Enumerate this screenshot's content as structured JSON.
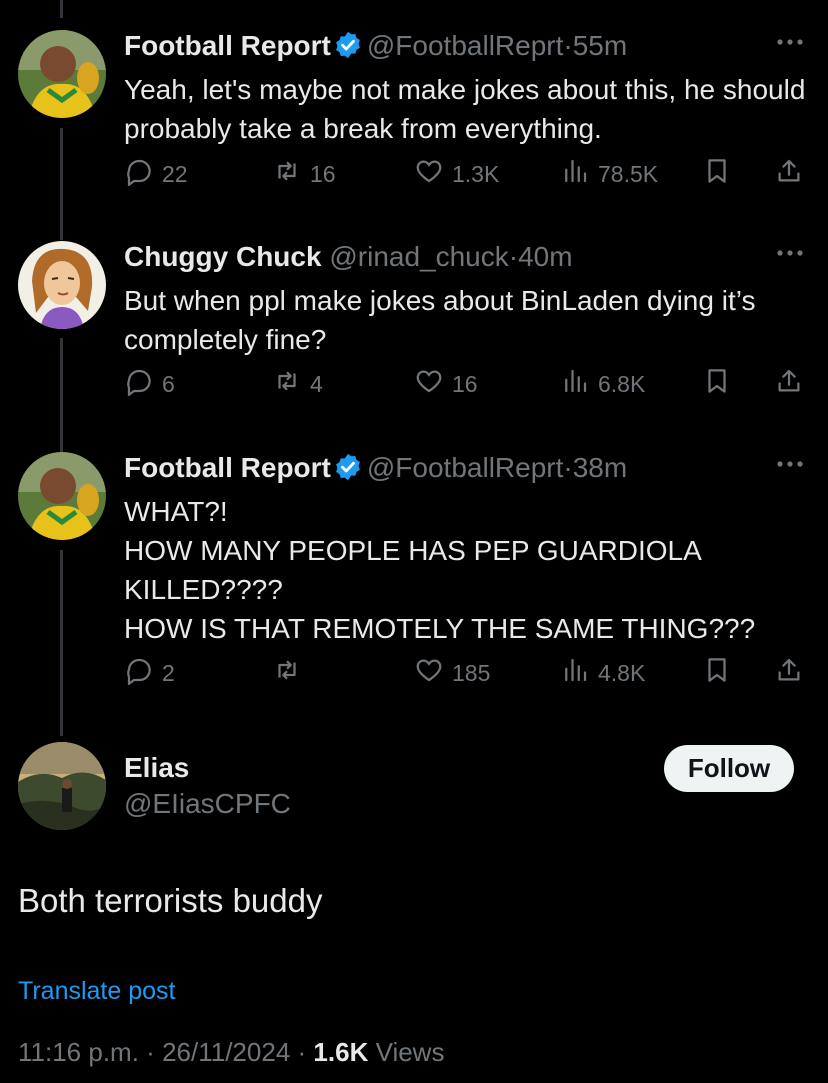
{
  "thread": [
    {
      "name": "Football Report",
      "handle": "@FootballReprt",
      "separator": "·",
      "time": "55m",
      "text": "Yeah, let's maybe not make jokes about this, he should probably take a break from everything.",
      "replies": "22",
      "reposts": "16",
      "likes": "1.3K",
      "views": "78.5K"
    },
    {
      "name": "Chuggy Chuck",
      "handle": "@rinad_chuck",
      "separator": "·",
      "time": "40m",
      "text": "But when ppl make jokes about BinLaden dying it’s completely fine?",
      "replies": "6",
      "reposts": "4",
      "likes": "16",
      "views": "6.8K"
    },
    {
      "name": "Football Report",
      "handle": "@FootballReprt",
      "separator": "·",
      "time": "38m",
      "lines": [
        "WHAT?!",
        "HOW MANY PEOPLE HAS PEP GUARDIOLA",
        "KILLED????",
        "HOW IS THAT REMOTELY THE SAME THING???"
      ],
      "replies": "2",
      "reposts": "",
      "likes": "185",
      "views": "4.8K"
    }
  ],
  "main_post": {
    "name": "Elias",
    "handle": "@EIiasCPFC",
    "follow_label": "Follow",
    "text": "Both terrorists buddy",
    "translate_label": "Translate post",
    "time": "11:16 p.m.",
    "date": "26/11/2024",
    "separator": "·",
    "views_count": "1.6K",
    "views_label": "Views"
  },
  "colors": {
    "background": "#000000",
    "text": "#e7e9ea",
    "muted": "#71767b",
    "accent": "#1d9bf0",
    "verified": "#1d9bf0"
  },
  "icons": [
    "reply-icon",
    "repost-icon",
    "like-icon",
    "views-icon",
    "bookmark-icon",
    "share-icon",
    "more-icon",
    "verified-badge-icon"
  ]
}
